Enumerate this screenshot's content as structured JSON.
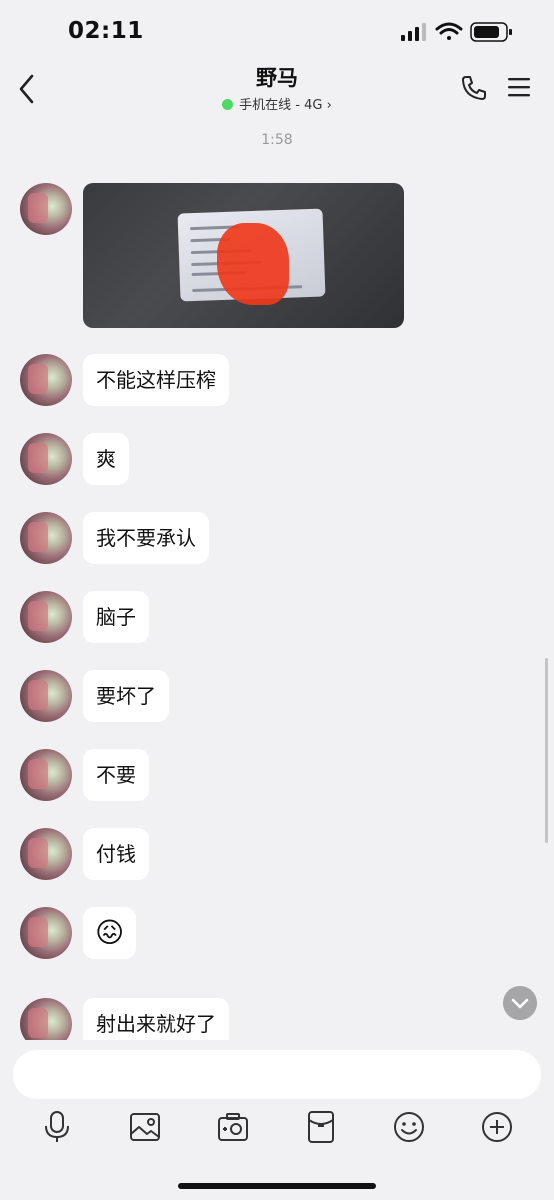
{
  "status_bar": {
    "time": "02:11"
  },
  "header": {
    "title": "野马",
    "subtitle": "手机在线 - 4G",
    "subtitle_arrow": "›"
  },
  "chat": {
    "timestamp": "1:58",
    "messages": [
      {
        "type": "image",
        "content": "id-card-photo"
      },
      {
        "type": "text",
        "text": "不能这样压榨"
      },
      {
        "type": "text",
        "text": "爽"
      },
      {
        "type": "text",
        "text": "我不要承认"
      },
      {
        "type": "text",
        "text": "脑子"
      },
      {
        "type": "text",
        "text": "要坏了"
      },
      {
        "type": "text",
        "text": "不要"
      },
      {
        "type": "text",
        "text": "付钱"
      },
      {
        "type": "emoji",
        "text": "😖"
      },
      {
        "type": "text",
        "text": "射出来就好了"
      }
    ]
  },
  "input": {
    "value": "",
    "placeholder": ""
  },
  "toolbar": {
    "icons": [
      "microphone-icon",
      "image-icon",
      "camera-icon",
      "red-packet-icon",
      "emoji-icon",
      "plus-icon"
    ]
  },
  "colors": {
    "background": "#f1f1f3",
    "bubble": "#ffffff",
    "online": "#4cd964",
    "timestamp": "#9a9a9a"
  }
}
